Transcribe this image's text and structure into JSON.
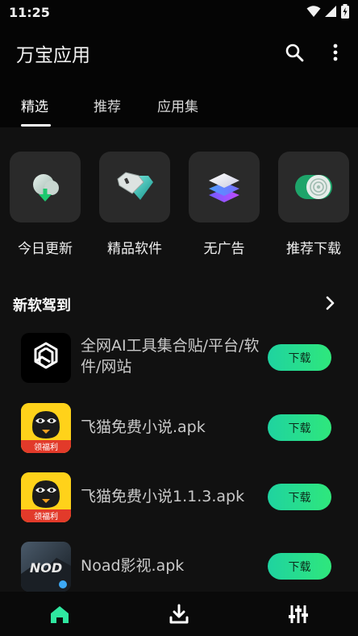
{
  "status": {
    "time": "11:25"
  },
  "app_bar": {
    "title": "万宝应用"
  },
  "tabs": [
    {
      "label": "精选",
      "active": true
    },
    {
      "label": "推荐",
      "active": false
    },
    {
      "label": "应用集",
      "active": false
    }
  ],
  "categories": [
    {
      "label": "今日更新",
      "icon": "cloud-download-icon"
    },
    {
      "label": "精品软件",
      "icon": "gem-icon"
    },
    {
      "label": "无广告",
      "icon": "layers-icon"
    },
    {
      "label": "推荐下载",
      "icon": "toggle-target-icon"
    }
  ],
  "section": {
    "title": "新软驾到"
  },
  "apps": [
    {
      "name": "全网AI工具集合贴/平台/软件/网站",
      "button": "下载",
      "icon": "openai-logo-icon"
    },
    {
      "name": "飞猫免费小说.apk",
      "button": "下载",
      "icon": "feimao-cat-icon",
      "badge": "领福利"
    },
    {
      "name": "飞猫免费小说1.1.3.apk",
      "button": "下载",
      "icon": "feimao-cat-icon",
      "badge": "领福利"
    },
    {
      "name": "Noad影视.apk",
      "button": "下载",
      "icon": "noad-app-icon",
      "logo_text": "NOD"
    }
  ],
  "colors": {
    "accent": "#2fe77c",
    "background": "#000000",
    "surface": "#111111",
    "tile": "#2a2a2a"
  }
}
